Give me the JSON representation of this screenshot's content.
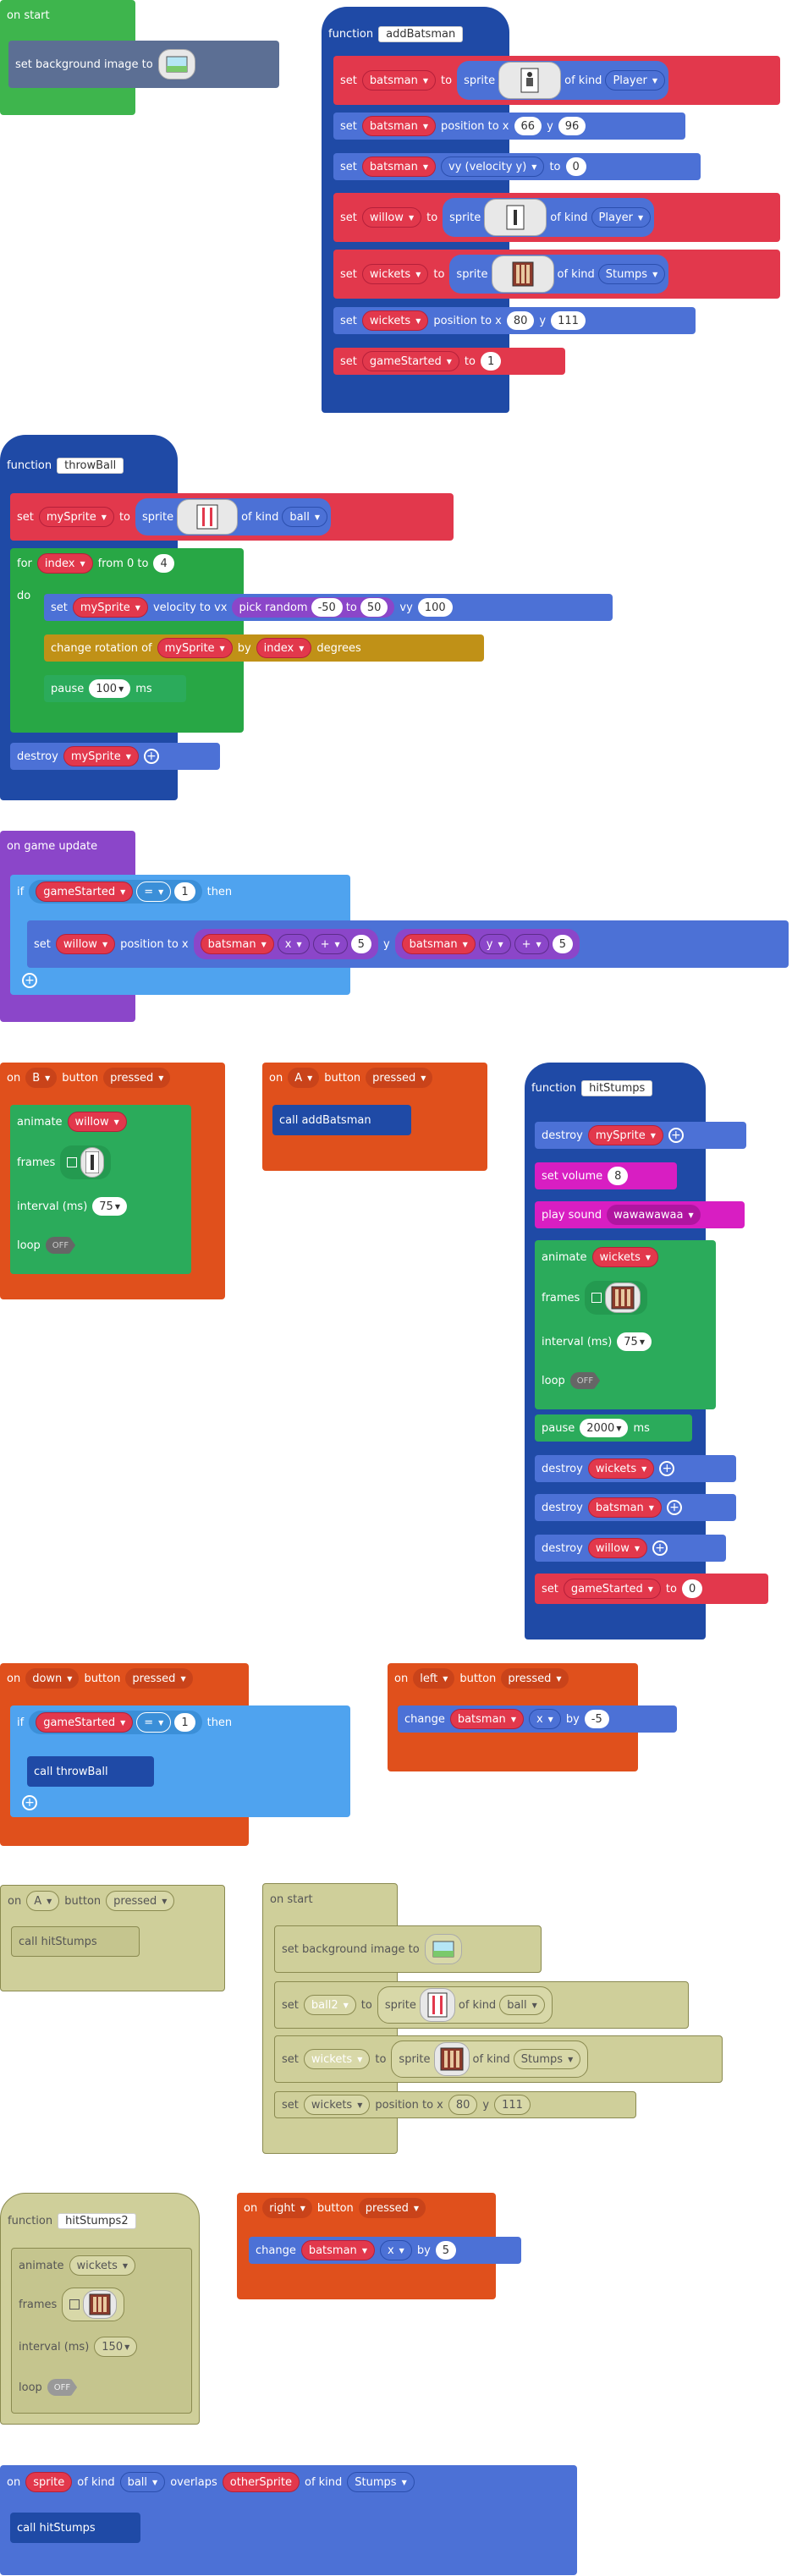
{
  "on_start_1": {
    "hat": "on start",
    "row": "set background image to"
  },
  "add_batsman": {
    "function_kw": "function",
    "name": "addBatsman",
    "set_kw": "set",
    "to_kw": "to",
    "sprite_kw": "sprite",
    "of_kind": "of kind",
    "position_kw": "position to x",
    "y_kw": "y",
    "vy_label": "vy (velocity y)",
    "batsman": "batsman",
    "willow": "willow",
    "wickets": "wickets",
    "game_started": "gameStarted",
    "player": "Player",
    "stumps": "Stumps",
    "bx": "66",
    "by": "96",
    "vy": "0",
    "wx": "80",
    "wy": "111",
    "gs": "1"
  },
  "throw_ball": {
    "function_kw": "function",
    "name": "throwBall",
    "set_kw": "set",
    "my_sprite": "mySprite",
    "to_kw": "to",
    "sprite_kw": "sprite",
    "of_kind": "of kind",
    "ball": "ball",
    "for_kw": "for",
    "index": "index",
    "from_kw": "from 0 to",
    "to_val": "4",
    "do_kw": "do",
    "velocity": "velocity to vx",
    "pick_random": "pick random",
    "rmin": "-50",
    "rto": "to",
    "rmax": "50",
    "vy_kw": "vy",
    "vy_val": "100",
    "change_rot": "change rotation of",
    "by_kw": "by",
    "degrees": "degrees",
    "pause_kw": "pause",
    "pause_val": "100",
    "ms": "ms",
    "destroy": "destroy"
  },
  "game_update": {
    "hat": "on game update",
    "if_kw": "if",
    "game_started": "gameStarted",
    "eq": "=",
    "one": "1",
    "then_kw": "then",
    "set_kw": "set",
    "willow": "willow",
    "position_kw": "position to x",
    "batsman": "batsman",
    "x_kw": "x",
    "plus": "+",
    "five": "5",
    "y_kw": "y"
  },
  "on_b": {
    "on_kw": "on",
    "btn": "B",
    "button_kw": "button",
    "pressed": "pressed",
    "animate": "animate",
    "willow": "willow",
    "frames": "frames",
    "interval": "interval (ms)",
    "interval_val": "75",
    "loop": "loop",
    "off": "OFF"
  },
  "on_a": {
    "on_kw": "on",
    "btn": "A",
    "button_kw": "button",
    "pressed": "pressed",
    "call": "call addBatsman"
  },
  "hit_stumps": {
    "function_kw": "function",
    "name": "hitStumps",
    "destroy": "destroy",
    "my_sprite": "mySprite",
    "set_volume": "set volume",
    "volume": "8",
    "play_sound": "play sound",
    "sound": "wawawawaa",
    "animate": "animate",
    "wickets": "wickets",
    "frames": "frames",
    "interval": "interval (ms)",
    "interval_val": "75",
    "loop": "loop",
    "off": "OFF",
    "pause": "pause",
    "pause_val": "2000",
    "ms": "ms",
    "batsman": "batsman",
    "willow": "willow",
    "set_kw": "set",
    "game_started": "gameStarted",
    "to_kw": "to",
    "zero": "0"
  },
  "on_down": {
    "on_kw": "on",
    "btn": "down",
    "button_kw": "button",
    "pressed": "pressed",
    "if_kw": "if",
    "game_started": "gameStarted",
    "eq": "=",
    "one": "1",
    "then_kw": "then",
    "call": "call throwBall"
  },
  "on_left": {
    "on_kw": "on",
    "btn": "left",
    "button_kw": "button",
    "pressed": "pressed",
    "change": "change",
    "batsman": "batsman",
    "x_kw": "x",
    "by_kw": "by",
    "val": "-5"
  },
  "on_a2": {
    "on_kw": "on",
    "btn": "A",
    "button_kw": "button",
    "pressed": "pressed",
    "call": "call hitStumps"
  },
  "on_start_2": {
    "hat": "on start",
    "bg": "set background image to",
    "set_kw": "set",
    "ball2": "ball2",
    "to_kw": "to",
    "sprite_kw": "sprite",
    "of_kind": "of kind",
    "ball": "ball",
    "wickets": "wickets",
    "stumps": "Stumps",
    "position_kw": "position to x",
    "x_val": "80",
    "y_kw": "y",
    "y_val": "111"
  },
  "hit_stumps2": {
    "function_kw": "function",
    "name": "hitStumps2",
    "animate": "animate",
    "wickets": "wickets",
    "frames": "frames",
    "interval": "interval (ms)",
    "interval_val": "150",
    "loop": "loop",
    "off": "OFF"
  },
  "on_right": {
    "on_kw": "on",
    "btn": "right",
    "button_kw": "button",
    "pressed": "pressed",
    "change": "change",
    "batsman": "batsman",
    "x_kw": "x",
    "by_kw": "by",
    "val": "5"
  },
  "overlap": {
    "on_kw": "on",
    "sprite": "sprite",
    "of_kind": "of kind",
    "ball": "ball",
    "overlaps": "overlaps",
    "other": "otherSprite",
    "stumps": "Stumps",
    "call": "call hitStumps"
  }
}
